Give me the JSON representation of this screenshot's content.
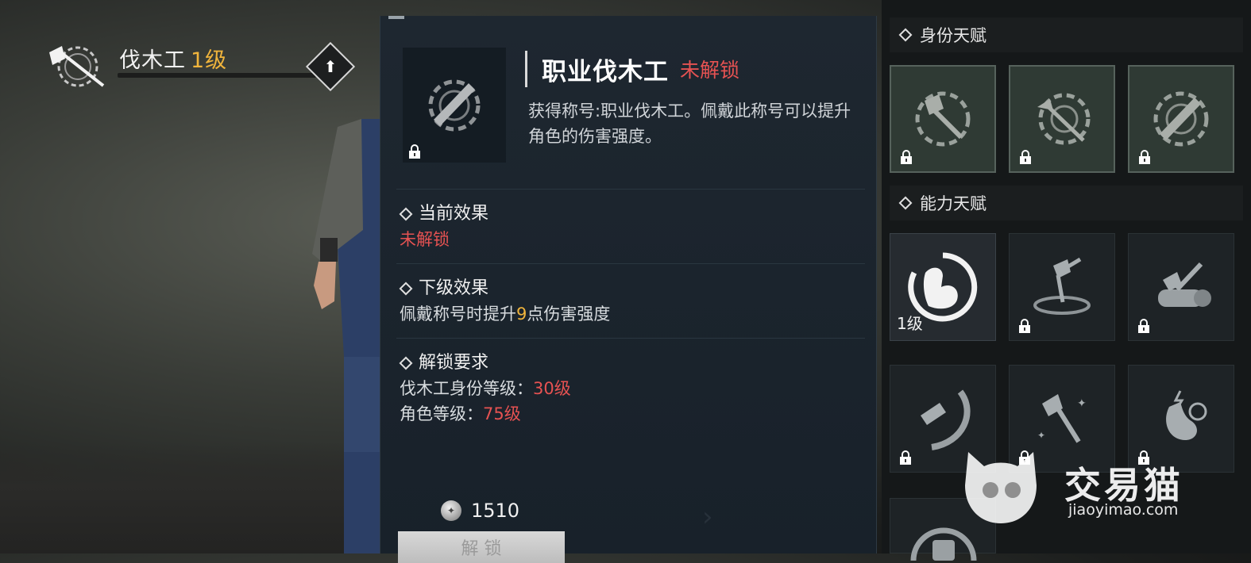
{
  "header": {
    "class_name": "伐木工",
    "class_level": "1级"
  },
  "detail": {
    "title": "职业伐木工",
    "status": "未解锁",
    "description": "获得称号:职业伐木工。佩戴此称号可以提升角色的伤害强度。",
    "current_effect": {
      "label": "当前效果",
      "value": "未解锁"
    },
    "next_effect": {
      "label": "下级效果",
      "text_prefix": "佩戴称号时提升",
      "amount": "9",
      "text_suffix": "点伤害强度"
    },
    "requirements": {
      "label": "解锁要求",
      "items": [
        {
          "label": "伐木工身份等级：",
          "value": "30级"
        },
        {
          "label": "角色等级：",
          "value": "75级"
        }
      ]
    },
    "cost": "1510",
    "unlock_button": "解 锁"
  },
  "identity_talents": {
    "header": "身份天赋",
    "slots": [
      {
        "icon": "axe-emblem-icon",
        "locked": true
      },
      {
        "icon": "crossed-log-emblem-icon",
        "locked": true
      },
      {
        "icon": "saw-emblem-icon",
        "locked": true
      }
    ]
  },
  "ability_talents": {
    "header": "能力天赋",
    "slots": [
      {
        "icon": "flexed-arm-icon",
        "level": "1级",
        "locked": false
      },
      {
        "icon": "axe-in-stump-icon",
        "locked": true
      },
      {
        "icon": "axe-on-log-icon",
        "locked": true
      },
      {
        "icon": "chainsaw-slash-icon",
        "locked": true
      },
      {
        "icon": "sparkling-axe-icon",
        "locked": true
      },
      {
        "icon": "stomach-potion-icon",
        "locked": true
      }
    ]
  },
  "watermark": {
    "brand": "交易猫",
    "url": "jiaoyimao.com"
  },
  "colors": {
    "accent_gold": "#f0b43c",
    "locked_red": "#e65252",
    "panel_bg": "#1e2730"
  }
}
